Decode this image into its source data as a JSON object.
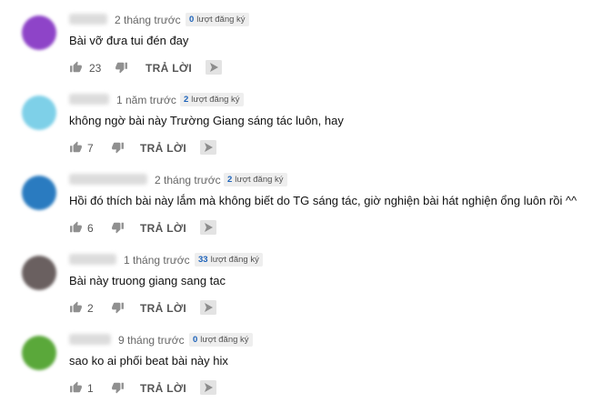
{
  "reply_label": "TRẢ LỜI",
  "icons": {
    "like": "thumbs-up-icon",
    "dislike": "thumbs-down-icon",
    "share": "share-icon"
  },
  "comments": [
    {
      "time": "2 tháng trước",
      "badge_count": "0",
      "badge_label": "lượt đăng ký",
      "text": "Bài vỡ đưa tui đén đay",
      "likes": "23",
      "avatar_color": "#8e44c8"
    },
    {
      "time": "1 năm trước",
      "badge_count": "2",
      "badge_label": "lượt đăng ký",
      "text": "không ngờ bài này Trường Giang sáng tác luôn, hay",
      "likes": "7",
      "avatar_color": "#7ed0e8"
    },
    {
      "time": "2 tháng trước",
      "badge_count": "2",
      "badge_label": "lượt đăng ký",
      "text": "Hồi đó thích bài này lắm mà không biết do TG sáng tác, giờ nghiện bài hát nghiện ổng luôn rồi ^^",
      "likes": "6",
      "avatar_color": "#2a7bc0"
    },
    {
      "time": "1 tháng trước",
      "badge_count": "33",
      "badge_label": "lượt đăng ký",
      "text": "Bài này truong giang sang tac",
      "likes": "2",
      "avatar_color": "#6a6060"
    },
    {
      "time": "9 tháng trước",
      "badge_count": "0",
      "badge_label": "lượt đăng ký",
      "text": "sao ko ai phối beat bài này hix",
      "likes": "1",
      "avatar_color": "#5aa83a"
    }
  ]
}
